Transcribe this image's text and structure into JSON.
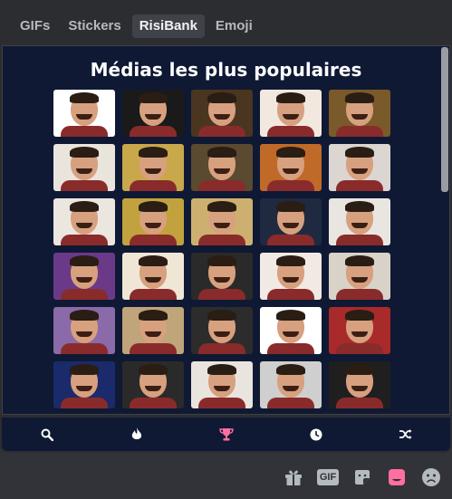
{
  "tabs": [
    {
      "label": "GIFs"
    },
    {
      "label": "Stickers"
    },
    {
      "label": "RisiBank",
      "active": true
    },
    {
      "label": "Emoji"
    }
  ],
  "panel": {
    "title": "Médias les plus populaires"
  },
  "thumbnails": [
    {
      "bg": "#ffffff",
      "face": true
    },
    {
      "bg": "#1a1a1a",
      "face": true
    },
    {
      "bg": "#4a3520",
      "face": true
    },
    {
      "bg": "#f2e8df",
      "face": true
    },
    {
      "bg": "#7a5a2a",
      "face": true
    },
    {
      "bg": "#e9e4dc",
      "face": true
    },
    {
      "bg": "#c9a84b",
      "face": true
    },
    {
      "bg": "#5a4a30",
      "face": true
    },
    {
      "bg": "#c06a2a",
      "face": true
    },
    {
      "bg": "#dcd6d2",
      "face": true
    },
    {
      "bg": "#ece6e0",
      "face": true
    },
    {
      "bg": "#c2a23e",
      "face": true
    },
    {
      "bg": "#cdb070",
      "face": true
    },
    {
      "bg": "#1f2a40",
      "face": true
    },
    {
      "bg": "#e9e6e2",
      "face": true
    },
    {
      "bg": "#6a3a88",
      "face": true
    },
    {
      "bg": "#efe6d6",
      "face": true
    },
    {
      "bg": "#2a2a2a",
      "face": true
    },
    {
      "bg": "#f1e9e4",
      "face": true
    },
    {
      "bg": "#d8d2c8",
      "face": true
    },
    {
      "bg": "#8a6aa8",
      "face": true
    },
    {
      "bg": "#c0a47a",
      "face": true
    },
    {
      "bg": "#2c2c2c",
      "face": true
    },
    {
      "bg": "#ffffff",
      "face": true
    },
    {
      "bg": "#a82a2a",
      "face": true
    },
    {
      "bg": "#1a2a6a",
      "face": true
    },
    {
      "bg": "#2a2a2a",
      "face": true
    },
    {
      "bg": "#e9e4de",
      "face": true
    },
    {
      "bg": "#cfcfcf",
      "face": true
    },
    {
      "bg": "#1f1f1f",
      "face": true
    }
  ],
  "bottombar": {
    "icons": [
      "search-icon",
      "fire-icon",
      "trophy-icon",
      "clock-icon",
      "shuffle-icon"
    ],
    "active_index": 2,
    "active_color": "#ff6fa0",
    "icon_color": "#ffffff"
  },
  "chatbar": {
    "icons": [
      "gift-icon",
      "gif-icon",
      "sticker-icon",
      "risibank-icon",
      "emoji-icon"
    ],
    "gif_label": "GIF",
    "risibank_color": "#ff6fa0",
    "icon_color": "#b5bac1"
  },
  "colors": {
    "panel_bg": "#0f1934",
    "app_bg": "#313338"
  }
}
